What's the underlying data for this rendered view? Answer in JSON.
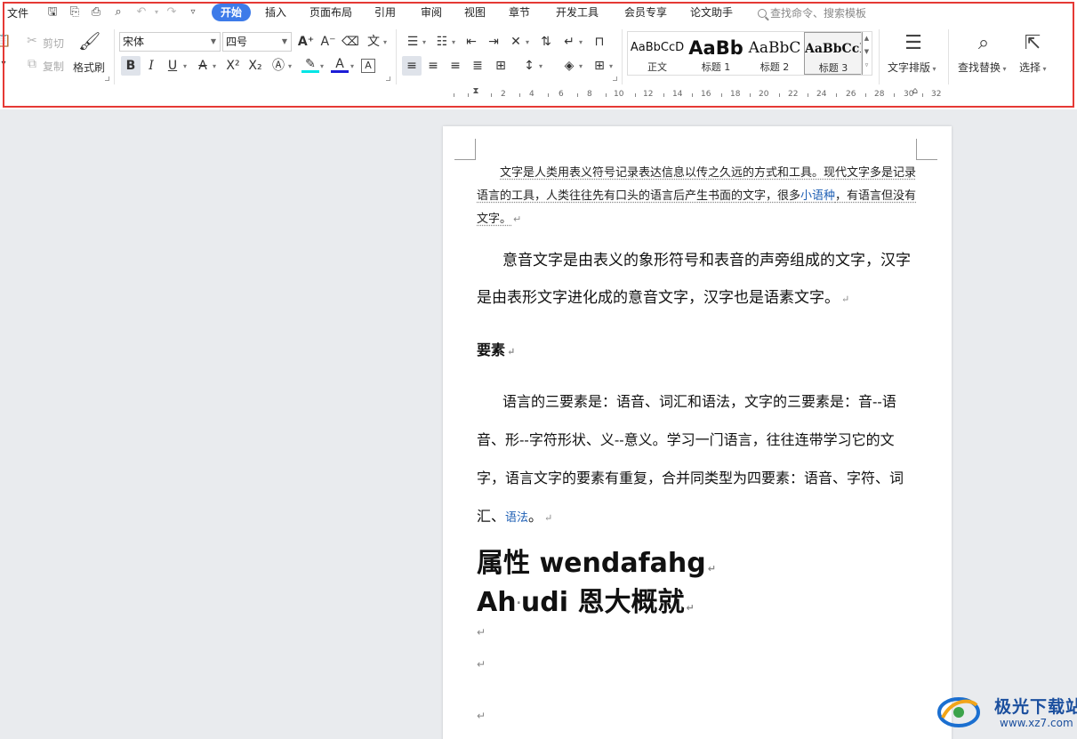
{
  "menubar": {
    "file": "文件",
    "tabs": [
      "开始",
      "插入",
      "页面布局",
      "引用",
      "审阅",
      "视图",
      "章节",
      "开发工具",
      "会员专享",
      "论文助手"
    ],
    "search_placeholder": "查找命令、搜索模板"
  },
  "clipboard": {
    "cut": "剪切",
    "copy": "复制",
    "format_painter": "格式刷"
  },
  "font": {
    "name": "宋体",
    "size": "四号"
  },
  "styles": [
    {
      "sample": "AaBbCcD",
      "name": "正文"
    },
    {
      "sample": "AaBb",
      "name": "标题 1"
    },
    {
      "sample": "AaBbC",
      "name": "标题 2"
    },
    {
      "sample": "AaBbCcI",
      "name": "标题 3"
    }
  ],
  "actions": {
    "text_layout": "文字排版",
    "find_replace": "查找替换",
    "select": "选择"
  },
  "ruler": [
    "2",
    "4",
    "6",
    "8",
    "10",
    "12",
    "14",
    "16",
    "18",
    "20",
    "22",
    "24",
    "26",
    "28",
    "30",
    "32"
  ],
  "document": {
    "p1_a": "文字是人类用表义符号记录表达信息以传之久远的方式和工具。现代文字多是记录语言的工具，人类往往先有口头的语言后产生书面的文字，很多",
    "p1_link": "小语种",
    "p1_b": "，有语言但没有文字。",
    "p2": "意音文字是由表义的象形符号和表音的声旁组成的文字，汉字是由表形文字进化成的意音文字，汉字也是语素文字。",
    "heading_req": "要素",
    "p3_a": "语言的三要素是：语音、词汇和语法，文字的三要素是：音--语音、形--字符形状、义--意义。学习一门语言，往往连带学习它的文字，语言文字的要素有重复，合并同类型为四要素：语音、字符、词汇、",
    "p3_link": "语法",
    "p3_b": "。",
    "heading_big1": "属性 wendafahg",
    "heading_big2_a": "Ah",
    "heading_big2_b": "udi 恩大概就",
    "para_mark": "↵"
  },
  "watermark": {
    "brand": "极光下载站",
    "url": "www.xz7.com"
  }
}
